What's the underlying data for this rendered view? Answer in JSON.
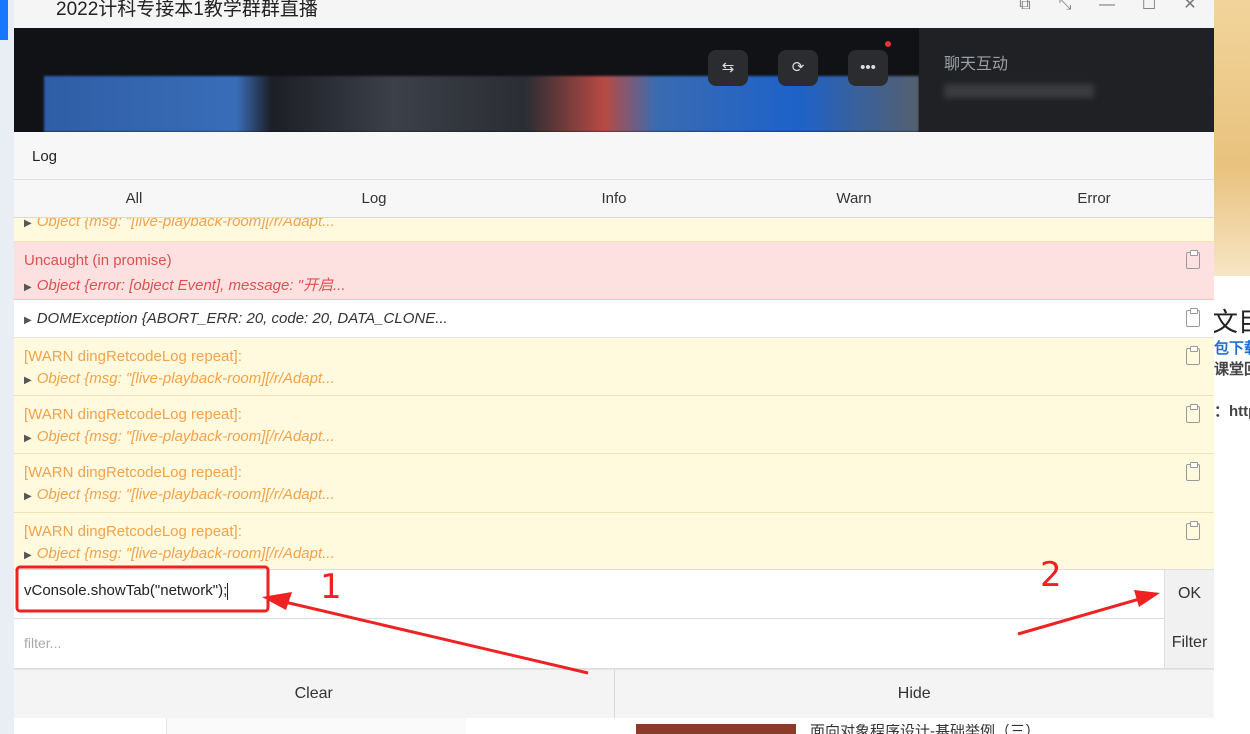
{
  "window": {
    "title": "2022计科专接本1教学群群直播",
    "controls": [
      "⧉",
      "⤡",
      "—",
      "☐",
      "✕"
    ]
  },
  "video": {
    "controls": [
      "⇆",
      "⟳",
      "•••"
    ],
    "chat_title": "聊天互动"
  },
  "background": {
    "right_text_1": "文目",
    "right_text_2": "包下载",
    "right_text_3": "课堂回",
    "right_text_4": "：http",
    "bottom_caption": "面向对象程序设计-基础举例（三）"
  },
  "vconsole": {
    "top_tab": "Log",
    "filter_tabs": [
      "All",
      "Log",
      "Info",
      "Warn",
      "Error"
    ],
    "active_tab": "All",
    "logs": [
      {
        "type": "warn",
        "line1": "",
        "line2": "Object {msg: \"[live-playback-room][/r/Adapt..."
      },
      {
        "type": "error",
        "line1": "Uncaught (in promise)",
        "line2": "Object {error: [object Event], message: \"开启..."
      },
      {
        "type": "log",
        "line1": "DOMException {ABORT_ERR: 20, code: 20, DATA_CLONE...",
        "line2": ""
      },
      {
        "type": "warn",
        "line1": "[WARN dingRetcodeLog repeat]:",
        "line2": "Object {msg: \"[live-playback-room][/r/Adapt..."
      },
      {
        "type": "warn",
        "line1": "[WARN dingRetcodeLog repeat]:",
        "line2": "Object {msg: \"[live-playback-room][/r/Adapt..."
      },
      {
        "type": "warn",
        "line1": "[WARN dingRetcodeLog repeat]:",
        "line2": "Object {msg: \"[live-playback-room][/r/Adapt..."
      },
      {
        "type": "warn",
        "line1": "[WARN dingRetcodeLog repeat]:",
        "line2": "Object {msg: \"[live-playback-room][/r/Adapt..."
      }
    ],
    "command_value": "vConsole.showTab(\"network\");",
    "ok_label": "OK",
    "filter_placeholder": "filter...",
    "filter_label": "Filter",
    "clear_label": "Clear",
    "hide_label": "Hide"
  },
  "annotations": {
    "color": "#ee2222",
    "label_1": "1",
    "label_2": "2"
  }
}
